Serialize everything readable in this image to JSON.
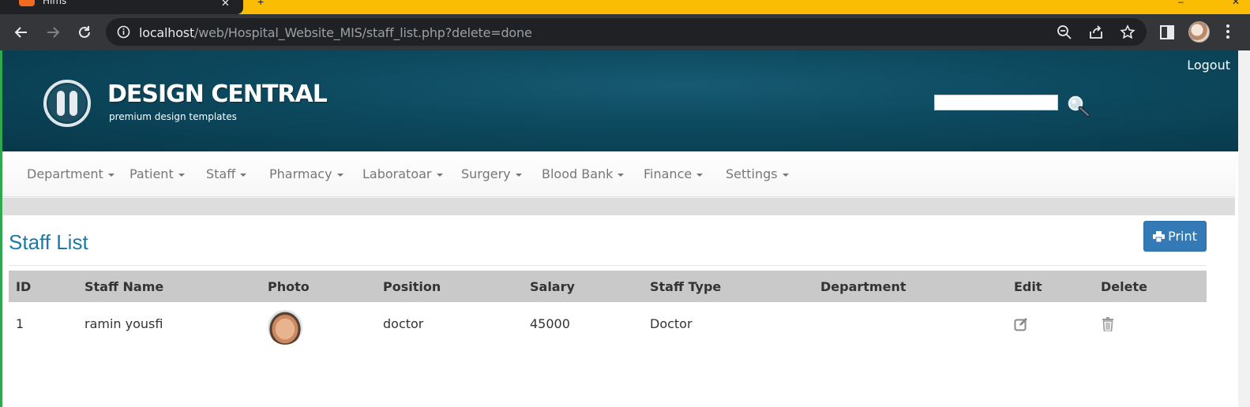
{
  "browser": {
    "tab_title": "Hims",
    "url_host": "localhost",
    "url_path": "/web/Hospital_Website_MIS/staff_list.php?delete=done"
  },
  "header": {
    "logout_label": "Logout",
    "logo_title": "DESIGN CENTRAL",
    "logo_subtitle": "premium design templates",
    "search_placeholder": ""
  },
  "nav": {
    "items": [
      {
        "label": "Department"
      },
      {
        "label": "Patient"
      },
      {
        "label": "Staff"
      },
      {
        "label": "Pharmacy"
      },
      {
        "label": "Laboratoar"
      },
      {
        "label": "Surgery"
      },
      {
        "label": "Blood Bank"
      },
      {
        "label": "Finance"
      },
      {
        "label": "Settings"
      }
    ]
  },
  "page": {
    "title": "Staff List",
    "print_label": "Print"
  },
  "table": {
    "columns": [
      "ID",
      "Staff Name",
      "Photo",
      "Position",
      "Salary",
      "Staff Type",
      "Department",
      "Edit",
      "Delete"
    ],
    "rows": [
      {
        "id": "1",
        "name": "ramin yousfi",
        "position": "doctor",
        "salary": "45000",
        "staff_type": "Doctor",
        "department": ""
      }
    ]
  },
  "colors": {
    "accent": "#337ab7",
    "title": "#1a7aa5",
    "banner": "#0d4a60",
    "browser_tabstrip": "#fbbc04"
  }
}
